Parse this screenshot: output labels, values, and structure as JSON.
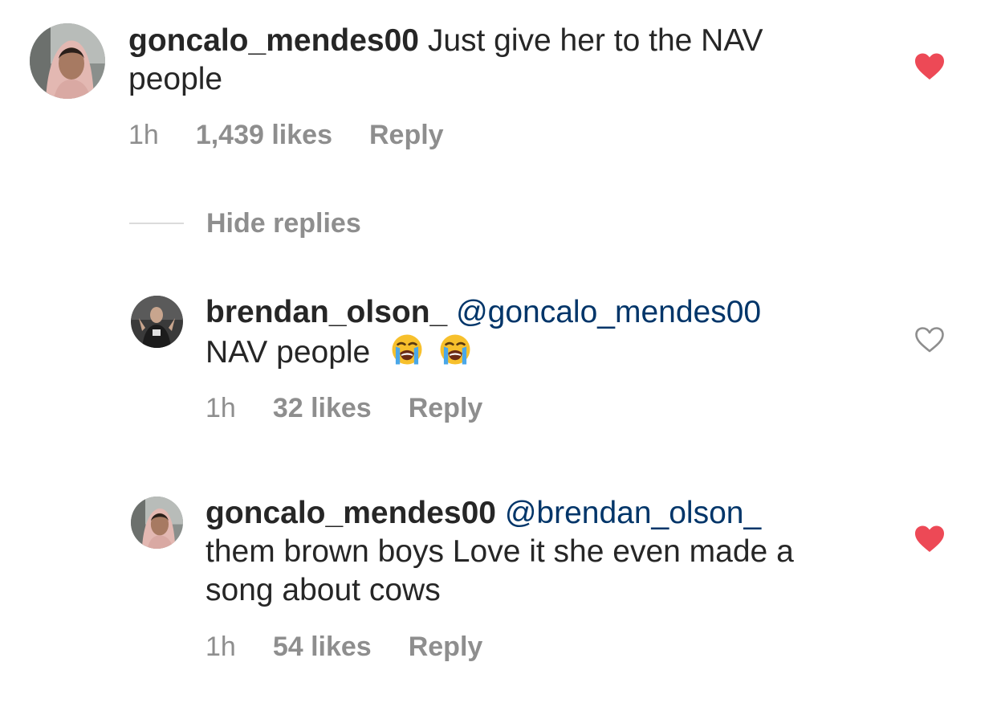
{
  "comments": [
    {
      "username": "goncalo_mendes00",
      "mention": "",
      "text_line1": "Just give her to the NAV",
      "text_line2": "people",
      "time": "1h",
      "likes": "1,439 likes",
      "reply": "Reply",
      "liked": true,
      "heart_icon": "heart-filled-icon",
      "heart_color": "#ed4956"
    },
    {
      "username": "brendan_olson_",
      "mention": "@goncalo_mendes00",
      "text_line1": "NAV people",
      "emojis": [
        "loudly-crying-face-emoji",
        "loudly-crying-face-emoji"
      ],
      "time": "1h",
      "likes": "32 likes",
      "reply": "Reply",
      "liked": false,
      "heart_icon": "heart-outline-icon",
      "heart_color": "#8e8e8e"
    },
    {
      "username": "goncalo_mendes00",
      "mention": "@brendan_olson_",
      "text_line1": "them brown boys Love it she even made a",
      "text_line2": "song about cows",
      "time": "1h",
      "likes": "54 likes",
      "reply": "Reply",
      "liked": true,
      "heart_icon": "heart-filled-icon",
      "heart_color": "#ed4956"
    }
  ],
  "hide_replies_label": "Hide replies",
  "colors": {
    "username": "#262626",
    "mention": "#003569",
    "meta": "#8e8e8e",
    "divider": "#dbdbdb"
  }
}
